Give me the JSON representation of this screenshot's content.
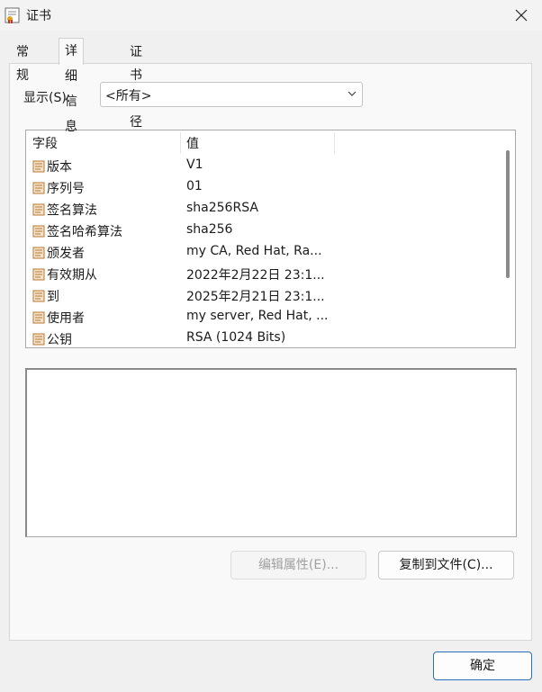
{
  "window": {
    "title": "证书"
  },
  "tabs": [
    {
      "label": "常规"
    },
    {
      "label": "详细信息"
    },
    {
      "label": "证书路径"
    }
  ],
  "show": {
    "label": "显示(S):",
    "selected": "<所有>"
  },
  "list": {
    "columns": [
      "字段",
      "值"
    ],
    "rows": [
      {
        "field": "版本",
        "value": "V1"
      },
      {
        "field": "序列号",
        "value": "01"
      },
      {
        "field": "签名算法",
        "value": "sha256RSA"
      },
      {
        "field": "签名哈希算法",
        "value": "sha256"
      },
      {
        "field": "颁发者",
        "value": "my CA, Red Hat, Ra..."
      },
      {
        "field": "有效期从",
        "value": "2022年2月22日 23:1..."
      },
      {
        "field": "到",
        "value": "2025年2月21日 23:1..."
      },
      {
        "field": "使用者",
        "value": "my server, Red Hat, ..."
      },
      {
        "field": "公钥",
        "value": "RSA (1024 Bits)"
      }
    ]
  },
  "buttons": {
    "edit_properties": "编辑属性(E)...",
    "copy_to_file": "复制到文件(C)...",
    "ok": "确定"
  }
}
